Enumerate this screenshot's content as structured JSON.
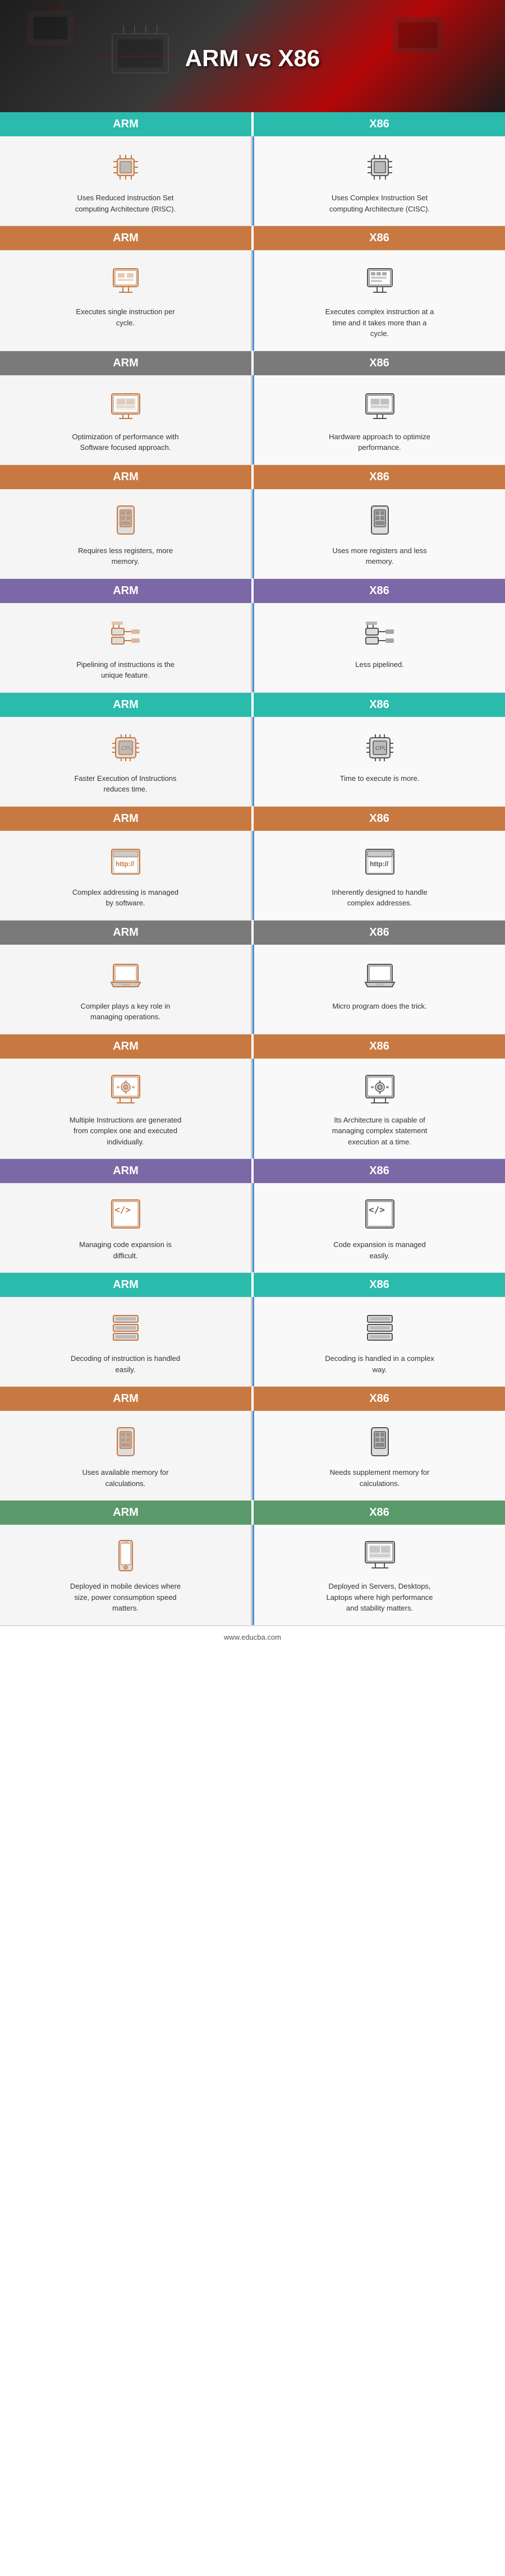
{
  "page": {
    "title": "ARM vs X86",
    "footer": "www.educba.com"
  },
  "sections": [
    {
      "header_color": "teal",
      "left_label": "ARM",
      "right_label": "X86",
      "left_text": "Uses Reduced Instruction Set computing Architecture (RISC).",
      "right_text": "Uses Complex Instruction Set computing Architecture (CISC).",
      "left_icon": "chip",
      "right_icon": "chip"
    },
    {
      "header_color": "orange",
      "left_label": "ARM",
      "right_label": "X86",
      "left_text": "Executes single instruction per cycle.",
      "right_text": "Executes complex instruction at a time and it takes more than a cycle.",
      "left_icon": "monitor-simple",
      "right_icon": "monitor-complex"
    },
    {
      "header_color": "gray",
      "left_label": "ARM",
      "right_label": "X86",
      "left_text": "Optimization of performance with Software focused approach.",
      "right_text": "Hardware approach to optimize performance.",
      "left_icon": "desktop",
      "right_icon": "desktop"
    },
    {
      "header_color": "orange",
      "left_label": "ARM",
      "right_label": "X86",
      "left_text": "Requires less registers, more memory.",
      "right_text": "Uses more registers and less memory.",
      "left_icon": "simcard",
      "right_icon": "simcard"
    },
    {
      "header_color": "purple",
      "left_label": "ARM",
      "right_label": "X86",
      "left_text": "Pipelining of instructions is the unique feature.",
      "right_text": "Less pipelined.",
      "left_icon": "pipeline",
      "right_icon": "pipeline"
    },
    {
      "header_color": "teal",
      "left_label": "ARM",
      "right_label": "X86",
      "left_text": "Faster Execution of Instructions reduces time.",
      "right_text": "Time to execute is more.",
      "left_icon": "chip2",
      "right_icon": "chip2"
    },
    {
      "header_color": "orange",
      "left_label": "ARM",
      "right_label": "X86",
      "left_text": "Complex addressing is managed by software.",
      "right_text": "Inherently designed to handle complex addresses.",
      "left_icon": "http",
      "right_icon": "http"
    },
    {
      "header_color": "gray",
      "left_label": "ARM",
      "right_label": "X86",
      "left_text": "Compiler plays a key role in managing operations.",
      "right_text": "Micro program does the trick.",
      "left_icon": "laptop",
      "right_icon": "laptop"
    },
    {
      "header_color": "orange",
      "left_label": "ARM",
      "right_label": "X86",
      "left_text": "Multiple Instructions are generated from complex one and executed individually.",
      "right_text": "Its Architecture is capable of managing complex statement execution at a time.",
      "left_icon": "gear-desktop",
      "right_icon": "gear-desktop"
    },
    {
      "header_color": "purple",
      "left_label": "ARM",
      "right_label": "X86",
      "left_text": "Managing code expansion is difficult.",
      "right_text": "Code expansion is managed easily.",
      "left_icon": "code",
      "right_icon": "code"
    },
    {
      "header_color": "teal",
      "left_label": "ARM",
      "right_label": "X86",
      "left_text": "Decoding of instruction is handled easily.",
      "right_text": "Decoding is handled in a complex way.",
      "left_icon": "layers",
      "right_icon": "layers"
    },
    {
      "header_color": "orange",
      "left_label": "ARM",
      "right_label": "X86",
      "left_text": "Uses available memory for calculations.",
      "right_text": "Needs supplement memory for calculations.",
      "left_icon": "simcard2",
      "right_icon": "simcard2"
    },
    {
      "header_color": "green",
      "left_label": "ARM",
      "right_label": "X86",
      "left_text": "Deployed in mobile devices where size, power consumption speed matters.",
      "right_text": "Deployed in Servers, Desktops, Laptops where high performance and stability matters.",
      "left_icon": "mobile",
      "right_icon": "desktop2"
    }
  ]
}
